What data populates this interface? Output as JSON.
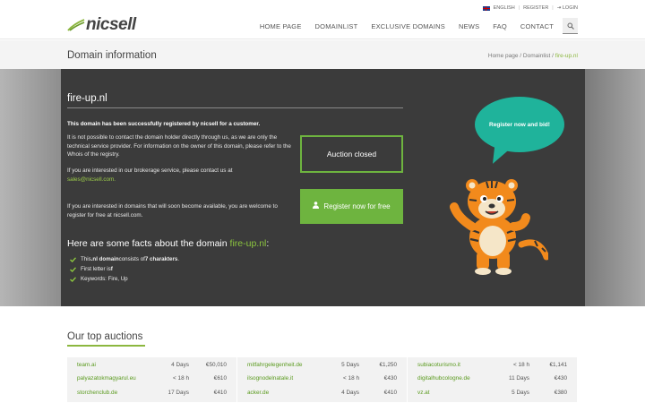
{
  "header": {
    "logo_text": "nicsell",
    "top_links": {
      "language": "ENGLISH",
      "register": "REGISTER",
      "login": "LOGIN"
    },
    "nav": [
      "HOME PAGE",
      "DOMAINLIST",
      "EXCLUSIVE DOMAINS",
      "NEWS",
      "FAQ",
      "CONTACT"
    ]
  },
  "subheader": {
    "title": "Domain information",
    "breadcrumb": [
      "Home page",
      "Domainlist",
      "fire-up.nl"
    ]
  },
  "domain": {
    "name": "fire-up.nl",
    "registered_msg": "This domain has been successfully registered by nicsell for a customer.",
    "contact_msg": "It is not possible to contact the domain holder directly through us, as we are only the technical service provider. For information on the owner of this domain, please refer to the Whois of the registry.",
    "brokerage_msg": "If you are interested in our brokerage service, please contact us at",
    "email": "sales@nicsell.com",
    "expiring_msg": "If you are interested in domains that will soon become available, you are welcome to register for free at nicsell.com.",
    "auction_status": "Auction closed",
    "register_button": "Register now for free",
    "bubble_text": "Register now and bid!"
  },
  "facts": {
    "heading": "Here are some facts about the domain",
    "domain": "fire-up.nl",
    "items": [
      {
        "pre": "This ",
        "b1": ".nl domain",
        "mid": " consists of ",
        "b2": "7 charakters",
        "post": "."
      },
      {
        "pre": "First letter is ",
        "b1": "f",
        "mid": "",
        "b2": "",
        "post": ""
      },
      {
        "pre": "Keywords: Fire, Up",
        "b1": "",
        "mid": "",
        "b2": "",
        "post": ""
      }
    ]
  },
  "top_auctions": {
    "title": "Our top auctions",
    "columns": [
      [
        {
          "domain": "team.ai",
          "time": "4 Days",
          "price": "€50,010"
        },
        {
          "domain": "palyazatokmagyarul.eu",
          "time": "< 18 h",
          "price": "€610"
        },
        {
          "domain": "storchenclub.de",
          "time": "17 Days",
          "price": "€410"
        }
      ],
      [
        {
          "domain": "mitfahrgelegenheit.de",
          "time": "5 Days",
          "price": "€1,250"
        },
        {
          "domain": "ilsognodelnatale.it",
          "time": "< 18 h",
          "price": "€430"
        },
        {
          "domain": "acker.de",
          "time": "4 Days",
          "price": "€410"
        }
      ],
      [
        {
          "domain": "subiacoturismo.it",
          "time": "< 18 h",
          "price": "€1,141"
        },
        {
          "domain": "digitalhubcologne.de",
          "time": "11 Days",
          "price": "€430"
        },
        {
          "domain": "vz.at",
          "time": "5 Days",
          "price": "€380"
        }
      ]
    ]
  },
  "colors": {
    "accent": "#8cb73f",
    "button": "#6eb43f",
    "bubble": "#1fb39b",
    "panel": "#3b3b3b"
  }
}
